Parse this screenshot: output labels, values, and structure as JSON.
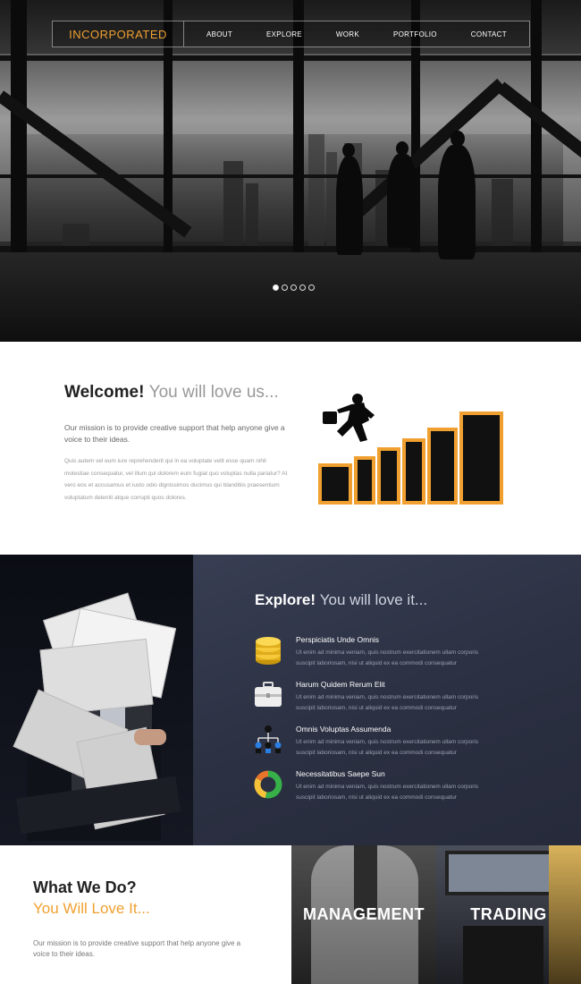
{
  "header": {
    "logo": "INCORPORATED",
    "menu": [
      "ABOUT",
      "EXPLORE",
      "WORK",
      "PORTFOLIO",
      "CONTACT"
    ]
  },
  "hero": {
    "slides": 5,
    "active_slide": 1
  },
  "welcome": {
    "title_bold": "Welcome!",
    "title_light": "You will love us...",
    "lead": "Our mission is to provide creative support that help anyone give a voice to their ideas.",
    "body": "Quis autem vel eum iure reprehenderit qui in ea voluptate velit esse quam nihil molestiae consequatur, vel illum qui dolorem eum fugiat quo voluptas nulla pariatur? At vero eos et accusamus et iusto odio dignissimos ducimus qui blanditiis praesentium voluptatum deleniti atque corrupti quos dolores."
  },
  "explore": {
    "title_bold": "Explore!",
    "title_light": "You will love it...",
    "features": [
      {
        "title": "Perspiciatis Unde Omnis",
        "icon": "coins-icon",
        "text": "Ut enim ad minima veniam, quis nostrum exercitationem ullam corporis suscipit laboriosam, nisi ut aliquid ex ea commodi consequatur"
      },
      {
        "title": "Harum Quidem Rerum Elit",
        "icon": "briefcase-icon",
        "text": "Ut enim ad minima veniam, quis nostrum exercitationem ullam corporis suscipit laboriosam, nisi ut aliquid ex ea commodi consequatur"
      },
      {
        "title": "Omnis Voluptas Assumenda",
        "icon": "org-chart-icon",
        "text": "Ut enim ad minima veniam, quis nostrum exercitationem ullam corporis suscipit laboriosam, nisi ut aliquid ex ea commodi consequatur"
      },
      {
        "title": "Necessitatibus Saepe Sun",
        "icon": "donut-chart-icon",
        "text": "Ut enim ad minima veniam, quis nostrum exercitationem ullam corporis suscipit laboriosam, nisi ut aliquid ex ea commodi consequatur"
      }
    ]
  },
  "what": {
    "title": "What We Do?",
    "subtitle": "You Will Love It...",
    "text": "Our mission is to provide creative support that help anyone give a voice to their ideas.",
    "tiles": [
      "MANAGEMENT",
      "TRADING"
    ]
  },
  "colors": {
    "accent": "#f0a030",
    "explore_bg": "#2f3447"
  }
}
